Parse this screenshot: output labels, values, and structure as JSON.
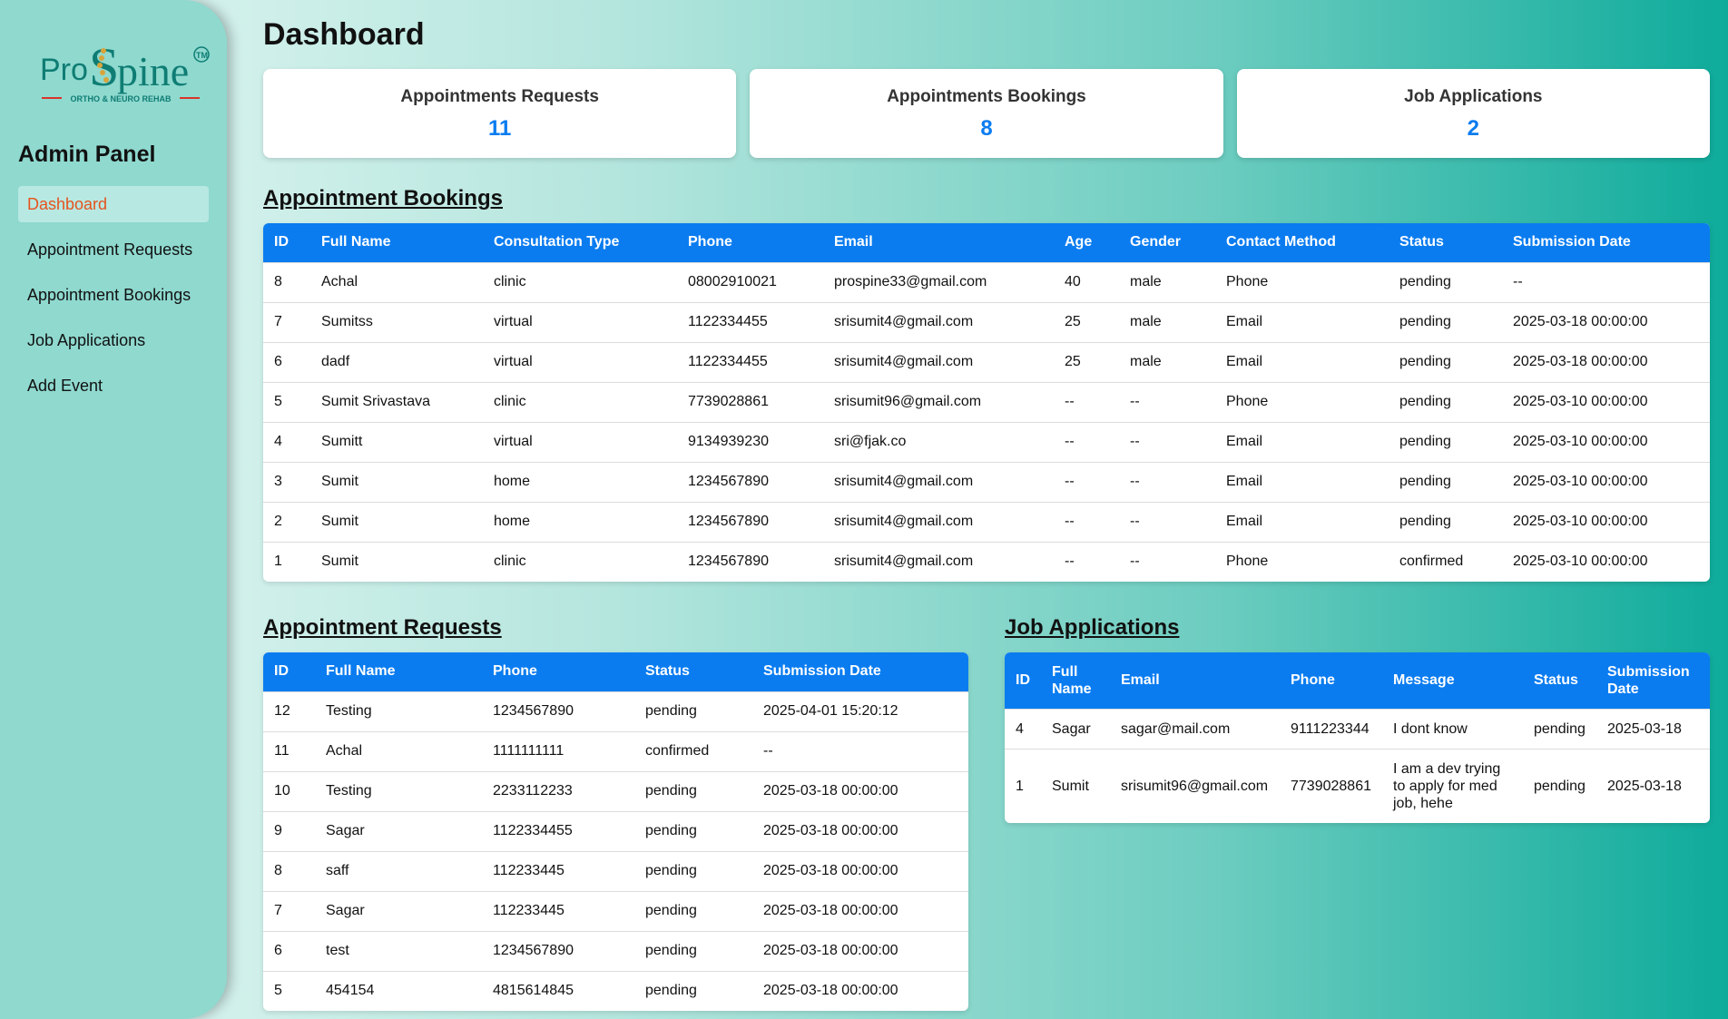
{
  "logo": {
    "text_pro": "Pro",
    "text_spine": "Spine",
    "tagline": "ORTHO & NEURO REHAB",
    "trademark": "TM"
  },
  "sidebar": {
    "title": "Admin Panel",
    "items": [
      {
        "label": "Dashboard",
        "active": true
      },
      {
        "label": "Appointment Requests",
        "active": false
      },
      {
        "label": "Appointment Bookings",
        "active": false
      },
      {
        "label": "Job Applications",
        "active": false
      },
      {
        "label": "Add Event",
        "active": false
      }
    ]
  },
  "page": {
    "title": "Dashboard"
  },
  "cards": [
    {
      "title": "Appointments Requests",
      "count": "11"
    },
    {
      "title": "Appointments Bookings",
      "count": "8"
    },
    {
      "title": "Job Applications",
      "count": "2"
    }
  ],
  "bookings": {
    "title": "Appointment Bookings",
    "columns": [
      "ID",
      "Full Name",
      "Consultation Type",
      "Phone",
      "Email",
      "Age",
      "Gender",
      "Contact Method",
      "Status",
      "Submission Date"
    ],
    "rows": [
      [
        "8",
        "Achal",
        "clinic",
        "08002910021",
        "prospine33@gmail.com",
        "40",
        "male",
        "Phone",
        "pending",
        "--"
      ],
      [
        "7",
        "Sumitss",
        "virtual",
        "1122334455",
        "srisumit4@gmail.com",
        "25",
        "male",
        "Email",
        "pending",
        "2025-03-18 00:00:00"
      ],
      [
        "6",
        "dadf",
        "virtual",
        "1122334455",
        "srisumit4@gmail.com",
        "25",
        "male",
        "Email",
        "pending",
        "2025-03-18 00:00:00"
      ],
      [
        "5",
        "Sumit Srivastava",
        "clinic",
        "7739028861",
        "srisumit96@gmail.com",
        "--",
        "--",
        "Phone",
        "pending",
        "2025-03-10 00:00:00"
      ],
      [
        "4",
        "Sumitt",
        "virtual",
        "9134939230",
        "sri@fjak.co",
        "--",
        "--",
        "Email",
        "pending",
        "2025-03-10 00:00:00"
      ],
      [
        "3",
        "Sumit",
        "home",
        "1234567890",
        "srisumit4@gmail.com",
        "--",
        "--",
        "Email",
        "pending",
        "2025-03-10 00:00:00"
      ],
      [
        "2",
        "Sumit",
        "home",
        "1234567890",
        "srisumit4@gmail.com",
        "--",
        "--",
        "Email",
        "pending",
        "2025-03-10 00:00:00"
      ],
      [
        "1",
        "Sumit",
        "clinic",
        "1234567890",
        "srisumit4@gmail.com",
        "--",
        "--",
        "Phone",
        "confirmed",
        "2025-03-10 00:00:00"
      ]
    ]
  },
  "requests": {
    "title": "Appointment Requests",
    "columns": [
      "ID",
      "Full Name",
      "Phone",
      "Status",
      "Submission Date"
    ],
    "rows": [
      [
        "12",
        "Testing",
        "1234567890",
        "pending",
        "2025-04-01 15:20:12"
      ],
      [
        "11",
        "Achal",
        "1111111111",
        "confirmed",
        "--"
      ],
      [
        "10",
        "Testing",
        "2233112233",
        "pending",
        "2025-03-18 00:00:00"
      ],
      [
        "9",
        "Sagar",
        "1122334455",
        "pending",
        "2025-03-18 00:00:00"
      ],
      [
        "8",
        "saff",
        "112233445",
        "pending",
        "2025-03-18 00:00:00"
      ],
      [
        "7",
        "Sagar",
        "112233445",
        "pending",
        "2025-03-18 00:00:00"
      ],
      [
        "6",
        "test",
        "1234567890",
        "pending",
        "2025-03-18 00:00:00"
      ],
      [
        "5",
        "454154",
        "4815614845",
        "pending",
        "2025-03-18 00:00:00"
      ]
    ]
  },
  "jobs": {
    "title": "Job Applications",
    "columns": [
      "ID",
      "Full Name",
      "Email",
      "Phone",
      "Message",
      "Status",
      "Submission Date"
    ],
    "rows": [
      [
        "4",
        "Sagar",
        "sagar@mail.com",
        "9111223344",
        "I dont know",
        "pending",
        "2025-03-18"
      ],
      [
        "1",
        "Sumit",
        "srisumit96@gmail.com",
        "7739028861",
        "I am a dev trying to apply for med job, hehe",
        "pending",
        "2025-03-18"
      ]
    ]
  },
  "colors": {
    "accent": "#0a7cf0",
    "active_nav": "#e5541e",
    "sidebar_bg": "#8fd9cf",
    "logo_teal": "#0f7d74",
    "logo_gold": "#d9a43a",
    "logo_red": "#d9342b"
  }
}
